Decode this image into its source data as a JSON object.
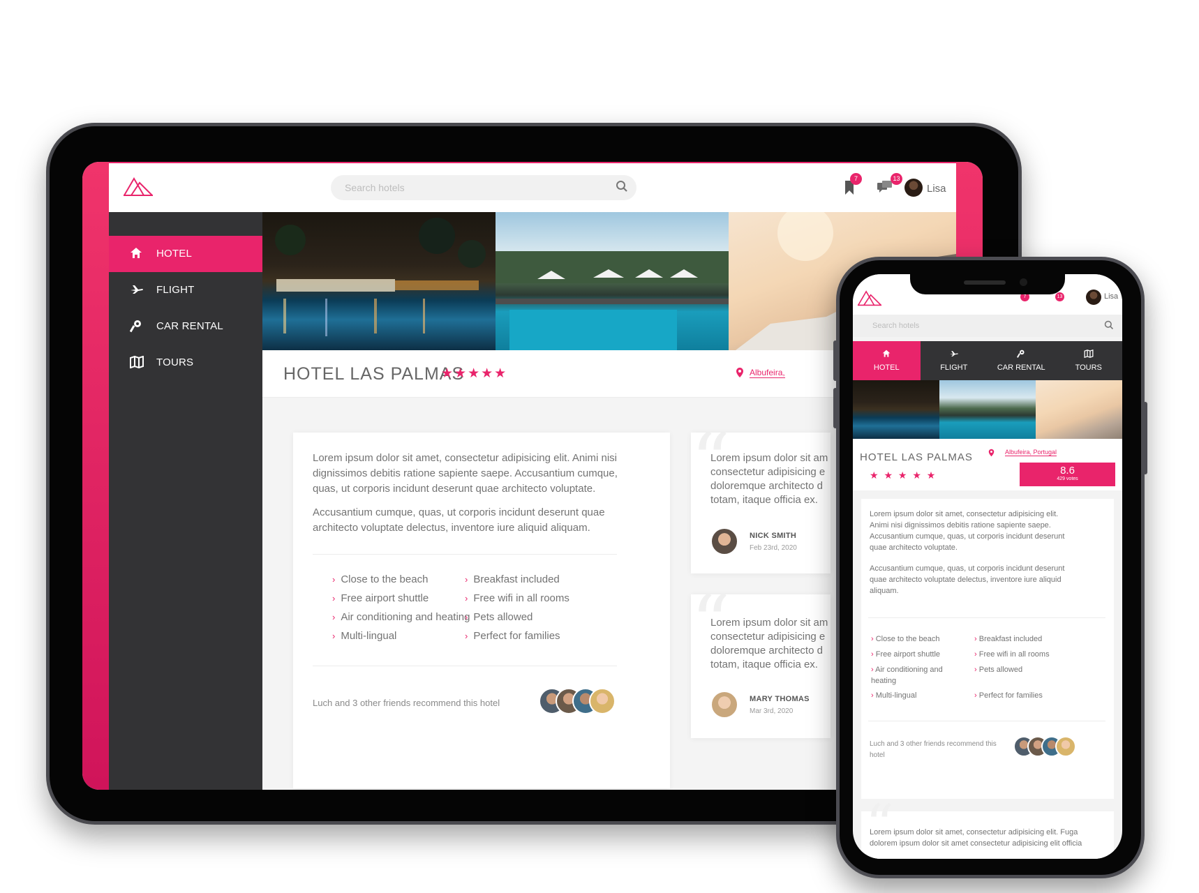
{
  "colors": {
    "accent": "#e9246b",
    "sidebar": "#333335",
    "text": "#737373"
  },
  "header": {
    "search_placeholder": "Search hotels",
    "bookmarks_badge": "7",
    "messages_badge": "13",
    "user_name": "Lisa"
  },
  "nav": [
    {
      "label": "HOTEL",
      "icon": "home-icon",
      "active": true
    },
    {
      "label": "FLIGHT",
      "icon": "plane-icon",
      "active": false
    },
    {
      "label": "CAR RENTAL",
      "icon": "key-icon",
      "active": false
    },
    {
      "label": "TOURS",
      "icon": "map-icon",
      "active": false
    }
  ],
  "hotel": {
    "name": "HOTEL LAS PALMAS",
    "stars": "★★★★★",
    "stars_mobile": "★ ★ ★ ★ ★",
    "location_short": "Albufeira,",
    "location": "Albufeira, Portugal",
    "score": "8.6",
    "votes": "429 votes"
  },
  "description": {
    "p1": "Lorem ipsum dolor sit amet, consectetur adipisicing elit. Animi nisi dignissimos debitis ratione sapiente saepe. Accusantium cumque, quas, ut corporis incidunt deserunt quae architecto voluptate.",
    "p2": "Accusantium cumque, quas, ut corporis incidunt deserunt quae architecto voluptate delectus, inventore iure aliquid aliquam."
  },
  "amenities": [
    "Close to the beach",
    "Breakfast included",
    "Free airport shuttle",
    "Free wifi in all rooms",
    "Air conditioning and heating",
    "Pets allowed",
    "Multi-lingual",
    "Perfect for families"
  ],
  "recommend": {
    "text": "Luch and 3 other friends recommend this hotel",
    "text_mobile_1": "Luch and 3 other friends recommend this",
    "text_mobile_2": "hotel"
  },
  "reviews": [
    {
      "text_lines": [
        "Lorem ipsum dolor sit am",
        "consectetur adipisicing e",
        "doloremque architecto d",
        "totam, itaque officia ex."
      ],
      "name": "NICK SMITH",
      "date": "Feb 23rd, 2020"
    },
    {
      "text_lines": [
        "Lorem ipsum dolor sit am",
        "consectetur adipisicing e",
        "doloremque architecto d",
        "totam, itaque officia ex."
      ],
      "name": "MARY THOMAS",
      "date": "Mar 3rd, 2020"
    }
  ],
  "mobile_review_lines": [
    "Lorem ipsum dolor sit amet, consectetur adipisicing elit. Fuga",
    "dolorem ipsum dolor sit amet consectetur adipisicing elit officia"
  ],
  "mobile_description": {
    "l1": "Lorem ipsum dolor sit amet, consectetur adipisicing elit.",
    "l2": "Animi nisi dignissimos debitis ratione sapiente saepe.",
    "l3": "Accusantium cumque, quas, ut corporis incidunt deserunt",
    "l4": "quae architecto voluptate.",
    "l5": "Accusantium cumque, quas, ut corporis incidunt deserunt",
    "l6": "quae architecto voluptate delectus, inventore iure aliquid",
    "l7": "aliquam."
  },
  "mobile_amenities": {
    "a1": "Close to the beach",
    "a2": "Breakfast included",
    "a3": "Free airport shuttle",
    "a4": "Free wifi in all rooms",
    "a5": "Air conditioning and",
    "a5b": "heating",
    "a6": "Pets allowed",
    "a7": "Multi-lingual",
    "a8": "Perfect for families"
  }
}
